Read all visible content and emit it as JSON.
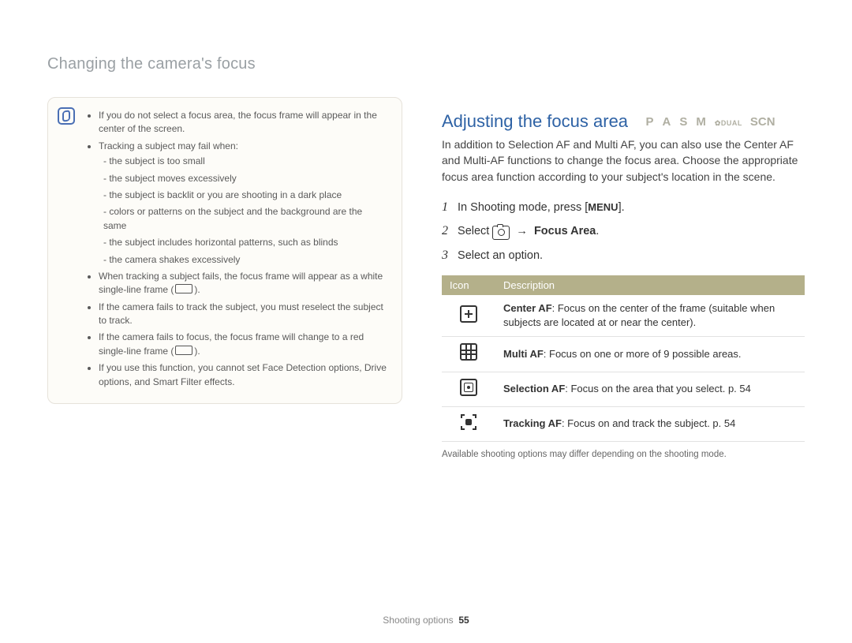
{
  "breadcrumb": "Changing the camera's focus",
  "note": {
    "items": [
      "If you do not select a focus area, the focus frame will appear in the center of the screen.",
      {
        "text": "Tracking a subject may fail when:",
        "sub": [
          "the subject is too small",
          "the subject moves excessively",
          "the subject is backlit or you are shooting in a dark place",
          "colors or patterns on the subject and the background are the same",
          "the subject includes horizontal patterns, such as blinds",
          "the camera shakes excessively"
        ]
      },
      "When tracking a subject fails, the focus frame will appear as a white single-line frame (      ).",
      "If the camera fails to track the subject, you must reselect the subject to track.",
      "If the camera fails to focus, the focus frame will change to a red single-line frame (      ).",
      "If you use this function, you cannot set Face Detection options, Drive options, and Smart Filter effects."
    ]
  },
  "heading": "Adjusting the focus area",
  "modes": {
    "p": "P",
    "a": "A",
    "s": "S",
    "m": "M",
    "dual": "DUAL",
    "scn": "SCN"
  },
  "intro": "In addition to Selection AF and Multi AF, you can also use the Center AF and Multi-AF functions to change the focus area. Choose the appropriate focus area function according to your subject's location in the scene.",
  "steps": {
    "s1_pre": "In Shooting mode, press [",
    "s1_menu": "MENU",
    "s1_post": "].",
    "s2_pre": "Select ",
    "s2_post_bold": "Focus Area",
    "s2_end": ".",
    "s3": "Select an option."
  },
  "table": {
    "head_icon": "Icon",
    "head_desc": "Description",
    "rows": [
      {
        "title": "Center AF",
        "desc": ": Focus on the center of the frame (suitable when subjects are located at or near the center)."
      },
      {
        "title": "Multi AF",
        "desc": ": Focus on one or more of 9 possible areas."
      },
      {
        "title": "Selection AF",
        "desc": ": Focus on the area that you select. p. 54"
      },
      {
        "title": "Tracking AF",
        "desc": ": Focus on and track the subject. p. 54"
      }
    ]
  },
  "footnote": "Available shooting options may differ depending on the shooting mode.",
  "pagefoot": {
    "section": "Shooting options",
    "num": "55"
  }
}
